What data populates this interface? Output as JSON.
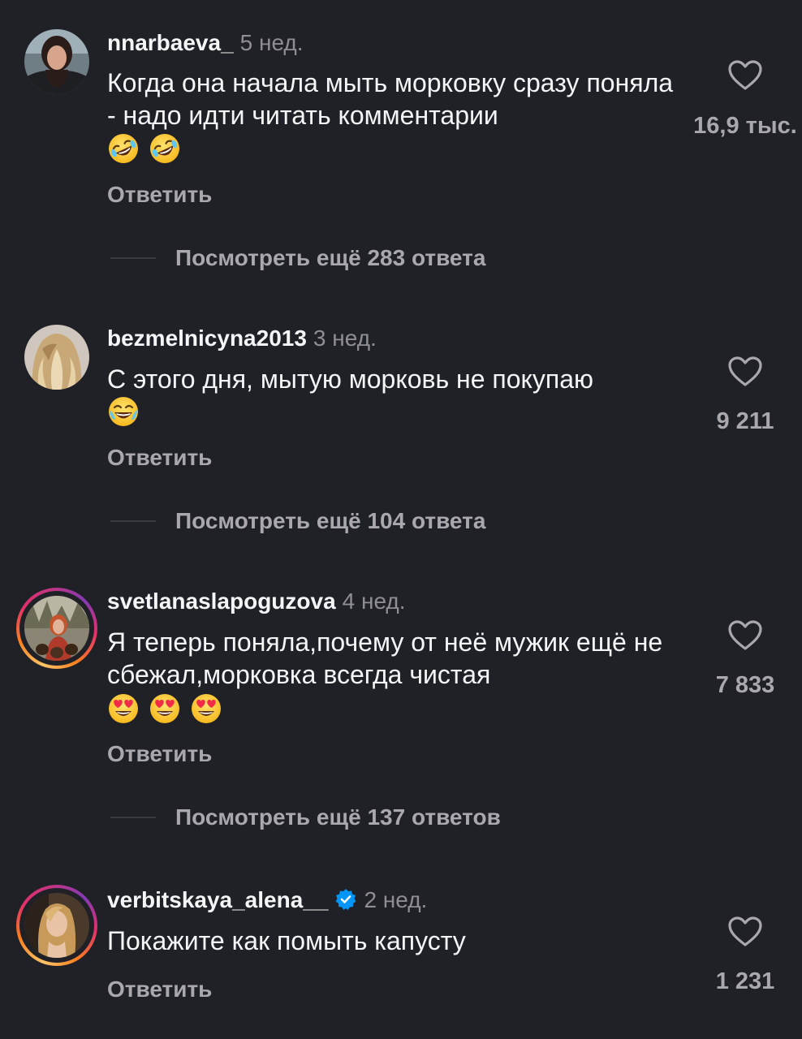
{
  "comments": [
    {
      "username": "nnarbaeva_",
      "time": "5 нед.",
      "text": "Когда она начала мыть морковку сразу поняла - надо идти читать комментарии",
      "emojis": [
        "rofl-emoji",
        "rofl-emoji"
      ],
      "reply_label": "Ответить",
      "likes": "16,9 тыс.",
      "more_replies": "Посмотреть ещё 283 ответа",
      "has_story_ring": false,
      "verified": false
    },
    {
      "username": "bezmelnicyna2013",
      "time": "3 нед.",
      "text": "С этого дня, мытую морковь не покупаю",
      "emojis": [
        "joy-emoji"
      ],
      "reply_label": "Ответить",
      "likes": "9 211",
      "more_replies": "Посмотреть ещё 104 ответа",
      "has_story_ring": false,
      "verified": false
    },
    {
      "username": "svetlanaslapoguzova",
      "time": "4 нед.",
      "text": "Я теперь поняла,почему от неё мужик ещё не сбежал,морковка всегда чистая",
      "emojis": [
        "heart-eyes-emoji",
        "heart-eyes-emoji",
        "heart-eyes-emoji"
      ],
      "reply_label": "Ответить",
      "likes": "7 833",
      "more_replies": "Посмотреть ещё 137 ответов",
      "has_story_ring": true,
      "verified": false
    },
    {
      "username": "verbitskaya_alena__",
      "time": "2 нед.",
      "text": "Покажите как помыть капусту",
      "emojis": [],
      "reply_label": "Ответить",
      "likes": "1 231",
      "has_story_ring": true,
      "verified": true
    }
  ],
  "colors": {
    "background": "#202127",
    "primary_text": "#f3f5f7",
    "secondary_text": "#a8a8ad",
    "verified_badge": "#0095f6"
  }
}
